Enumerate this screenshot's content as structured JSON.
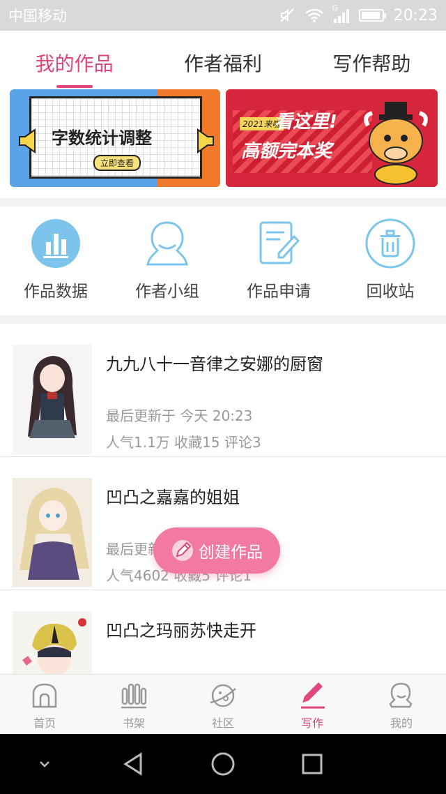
{
  "status_bar": {
    "carrier": "中国移动",
    "time": "20:23",
    "network": "G"
  },
  "tabs": [
    {
      "label": "我的作品",
      "active": true
    },
    {
      "label": "作者福利",
      "active": false
    },
    {
      "label": "写作帮助",
      "active": false
    }
  ],
  "banners": {
    "left": {
      "title": "字数统计调整",
      "button": "立即查看"
    },
    "right": {
      "tag": "2021来啦",
      "line1": "看这里!",
      "line2": "高额完本奖"
    }
  },
  "quick_entries": [
    {
      "label": "作品数据",
      "icon": "bar-chart-icon"
    },
    {
      "label": "作者小组",
      "icon": "group-icon"
    },
    {
      "label": "作品申请",
      "icon": "edit-document-icon"
    },
    {
      "label": "回收站",
      "icon": "trash-icon"
    }
  ],
  "works": [
    {
      "title": "九九八十一音律之安娜的厨窗",
      "updated": "最后更新于 今天 20:23",
      "stats": "人气1.1万 收藏15 评论3"
    },
    {
      "title": "凹凸之嘉嘉的姐姐",
      "updated": "最后更新于",
      "stats": "人气4602 收藏5 评论1"
    },
    {
      "title": "凹凸之玛丽苏快走开",
      "updated": "",
      "stats": ""
    }
  ],
  "fab": {
    "label": "创建作品"
  },
  "bottom_nav": [
    {
      "label": "首页",
      "icon": "home-icon",
      "active": false
    },
    {
      "label": "书架",
      "icon": "bookshelf-icon",
      "active": false
    },
    {
      "label": "社区",
      "icon": "community-icon",
      "active": false
    },
    {
      "label": "写作",
      "icon": "pen-icon",
      "active": true
    },
    {
      "label": "我的",
      "icon": "profile-icon",
      "active": false
    }
  ],
  "colors": {
    "accent": "#e0457b",
    "fab": "#f27aa0",
    "icon_blue": "#6fbde6"
  }
}
